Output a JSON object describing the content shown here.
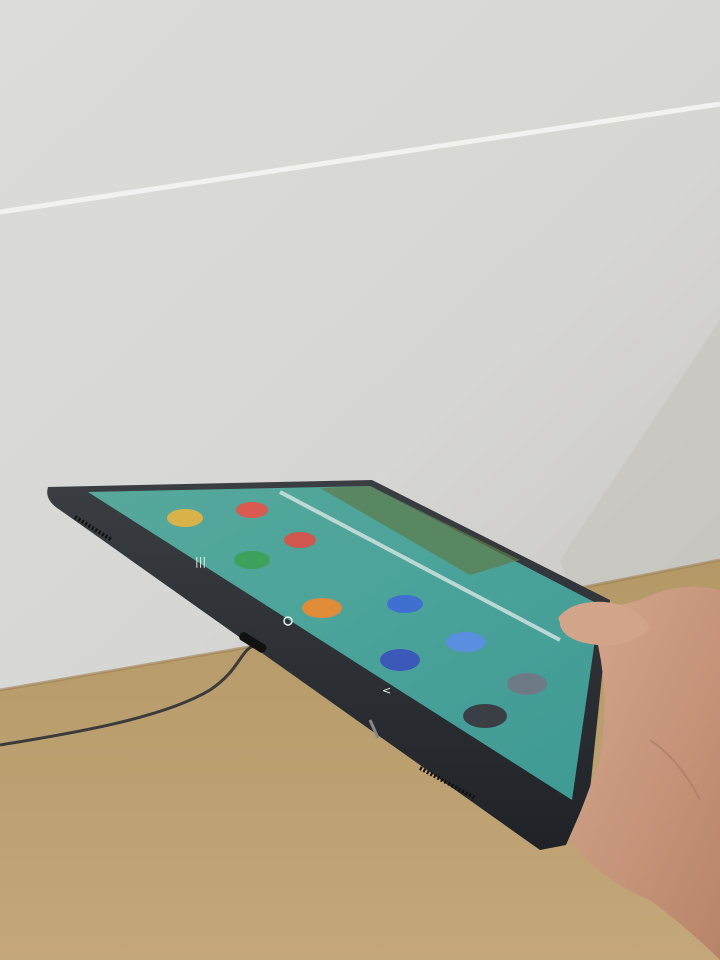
{
  "scene": {
    "subject": "tablet-held-in-hand",
    "device": {
      "screen": "home-screen",
      "wallpaper_color": "#4aa39a",
      "body_color": "#2b2f33",
      "nav_buttons": [
        "recents",
        "home",
        "back"
      ],
      "app_icons": [
        {
          "name": "app-icon-yellow",
          "color": "#d9b24a"
        },
        {
          "name": "app-icon-red",
          "color": "#d95a4f"
        },
        {
          "name": "app-icon-red-2",
          "color": "#d0574d"
        },
        {
          "name": "phone-app-icon",
          "color": "#3da15c"
        },
        {
          "name": "app-icon-orange",
          "color": "#e08b3a"
        },
        {
          "name": "app-icon-blue",
          "color": "#3f6fd0"
        },
        {
          "name": "app-icon-light-blue",
          "color": "#5a8fe0"
        },
        {
          "name": "app-icon-indigo",
          "color": "#3c58b8"
        },
        {
          "name": "app-icon-gray",
          "color": "#6e7b86"
        },
        {
          "name": "app-icon-dark",
          "color": "#3a3f45"
        }
      ]
    },
    "colors": {
      "wall": "#d9d9d7",
      "floor": "#b89a6a",
      "skin": "#c89a80"
    }
  }
}
